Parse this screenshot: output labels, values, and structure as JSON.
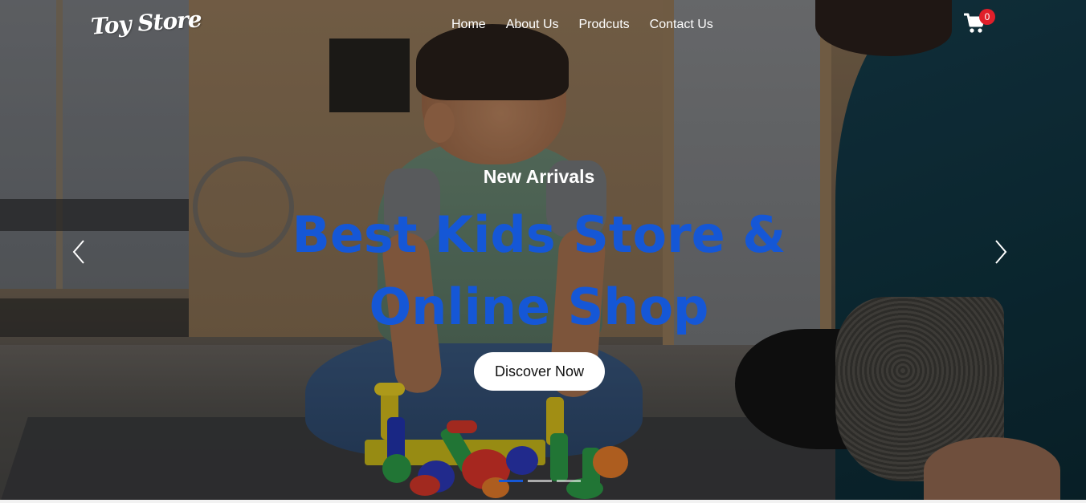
{
  "brand": {
    "logo_text": "Toy Store"
  },
  "nav": {
    "items": [
      {
        "label": "Home"
      },
      {
        "label": "About Us"
      },
      {
        "label": "Prodcuts"
      },
      {
        "label": "Contact Us"
      }
    ],
    "cart": {
      "icon": "cart-icon",
      "count": "0",
      "badge_color": "#e01f2a"
    }
  },
  "hero": {
    "eyebrow": "New Arrivals",
    "headline_line1": "Best Kids Store &",
    "headline_line2": "Online Shop",
    "cta_label": "Discover Now",
    "headline_color": "#1557d6"
  },
  "carousel": {
    "prev_icon": "chevron-left-icon",
    "next_icon": "chevron-right-icon",
    "slides_total": 3,
    "active_slide": 1
  }
}
